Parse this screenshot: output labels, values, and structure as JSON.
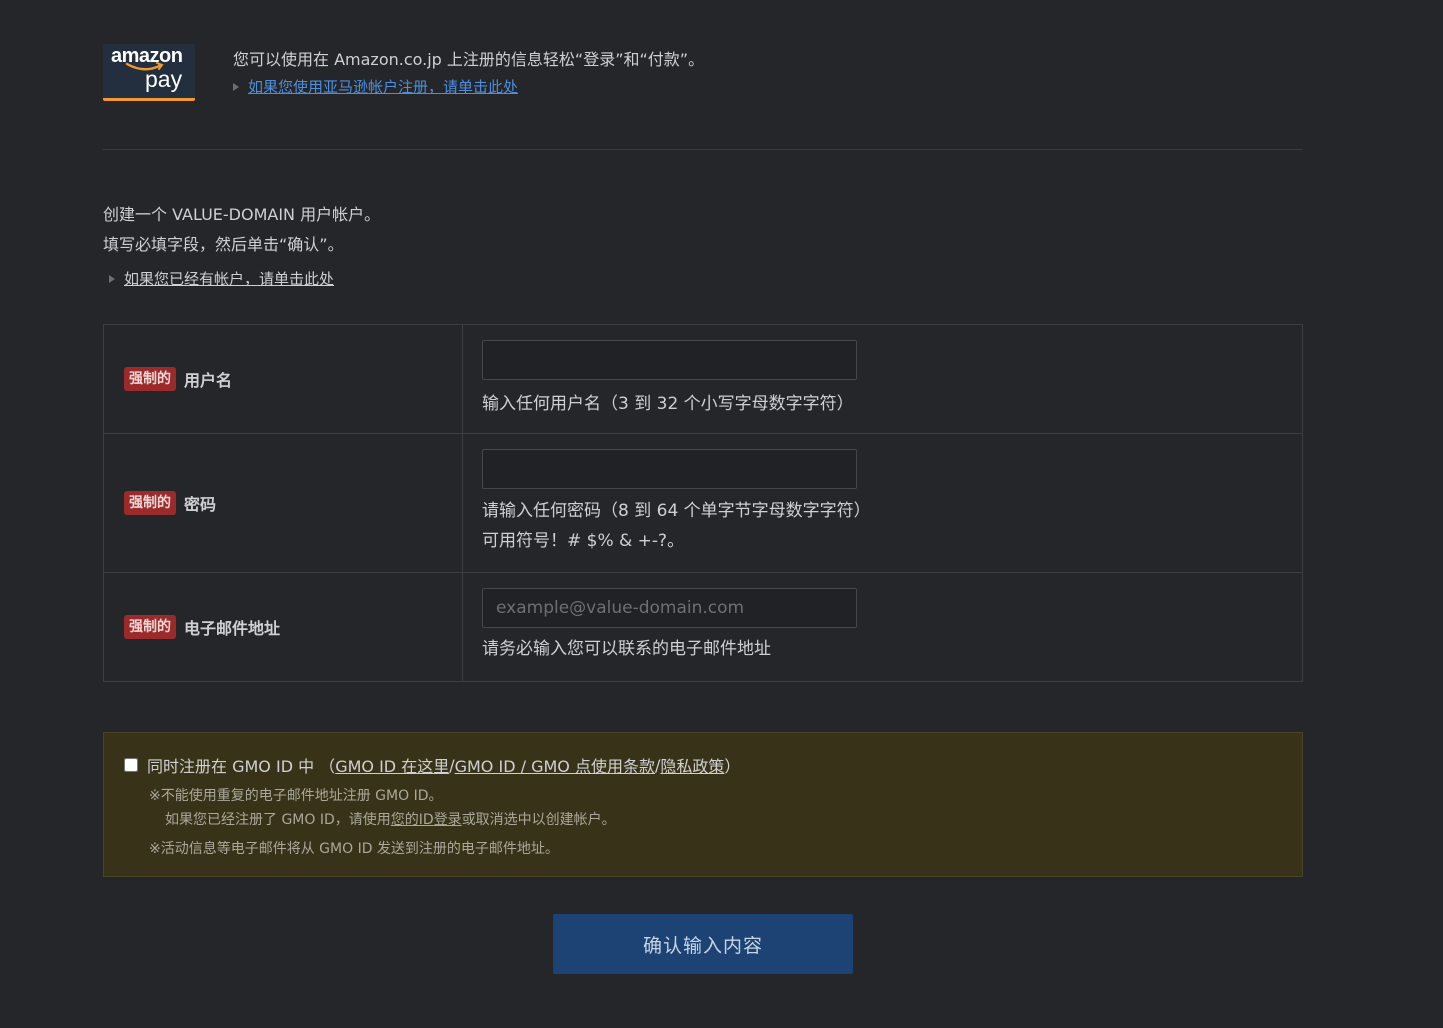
{
  "amazon": {
    "logo_word": "amazon",
    "logo_pay": "pay",
    "description": "您可以使用在 Amazon.co.jp 上注册的信息轻松“登录”和“付款”。",
    "link": "如果您使用亚马逊帐户注册，请单击此处"
  },
  "intro": {
    "line1": "创建一个 VALUE-DOMAIN 用户帐户。",
    "line2": "填写必填字段，然后单击“确认”。",
    "login_link": "如果您已经有帐户，请单击此处"
  },
  "form": {
    "required_badge": "强制的",
    "username": {
      "label": "用户名",
      "value": "",
      "hint": "输入任何用户名（3 到 32 个小写字母数字字符）"
    },
    "password": {
      "label": "密码",
      "value": "",
      "hint1": "请输入任何密码（8 到 64 个单字节字母数字字符）",
      "hint2": "可用符号！# $% & +-?。"
    },
    "email": {
      "label": "电子邮件地址",
      "placeholder": "example@value-domain.com",
      "hint": "请务必输入您可以联系的电子邮件地址"
    }
  },
  "gmo": {
    "checked": false,
    "label": "同时注册在 GMO ID 中 （",
    "link_here": "GMO ID 在这里",
    "sep1": "/ ",
    "link_terms": "GMO ID / GMO 点使用条款",
    "sep2": "/",
    "link_privacy": "隐私政策",
    "close": "）",
    "note1": "※不能使用重复的电子邮件地址注册 GMO ID。",
    "note2_a": "如果您已经注册了 GMO ID，请使用",
    "note2_link1": "您的ID",
    "note2_link2": "登录",
    "note2_b": "或取消选中以创建帐户。",
    "note3": "※活动信息等电子邮件将从 GMO ID 发送到注册的电子邮件地址。"
  },
  "submit_label": "确认输入内容",
  "colors": {
    "background": "#252629",
    "required_badge": "#9b2a2a",
    "gmo_box": "#383318",
    "submit": "#1c4373",
    "link_blue": "#4d8fdc",
    "amazon_orange": "#f29a2e"
  }
}
